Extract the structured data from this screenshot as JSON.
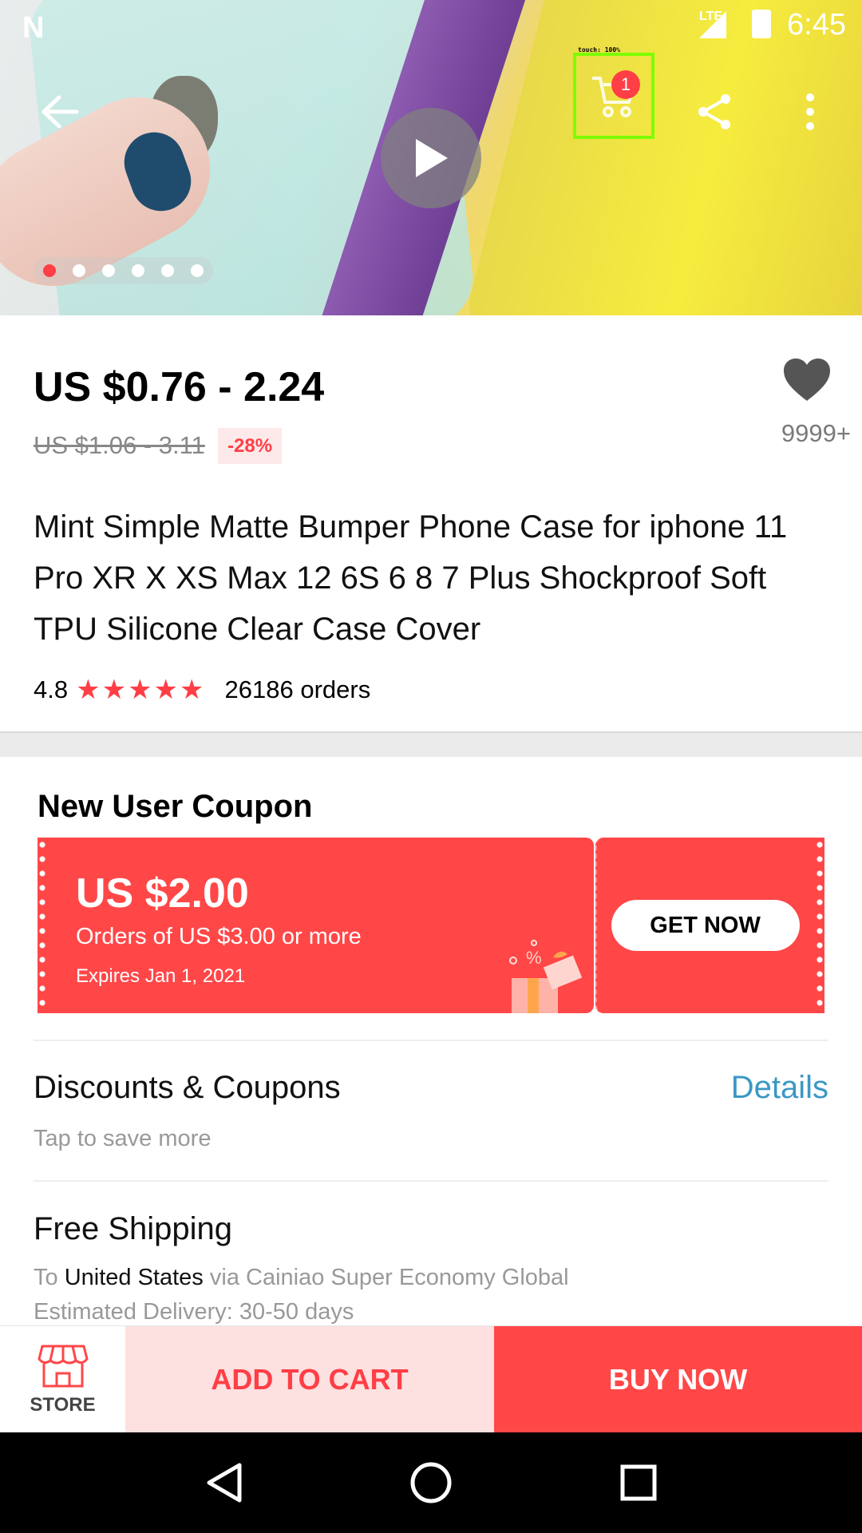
{
  "status_bar": {
    "clock": "6:45",
    "network": "LTE"
  },
  "hero": {
    "cart_count": "1",
    "touch_overlay": "touch: 100%",
    "gallery": {
      "count": 6,
      "active_index": 0
    }
  },
  "price": {
    "current": "US $0.76 - 2.24",
    "original": "US $1.06 - 3.11",
    "discount": "-28%",
    "wishlist_count": "9999+"
  },
  "product": {
    "title": "Mint Simple Matte Bumper Phone Case for iphone 11 Pro XR X XS Max 12 6S 6 8 7 Plus Shockproof Soft TPU Silicone Clear Case Cover",
    "rating": "4.8",
    "stars": 5,
    "orders": "26186 orders"
  },
  "coupon": {
    "heading": "New User Coupon",
    "amount": "US $2.00",
    "condition": "Orders of US $3.00 or more",
    "expires": "Expires Jan 1, 2021",
    "cta": "GET NOW"
  },
  "discounts": {
    "title": "Discounts & Coupons",
    "subtitle": "Tap to save more",
    "link": "Details"
  },
  "shipping": {
    "title": "Free Shipping",
    "to_prefix": "To",
    "country": "United States",
    "via": "via Cainiao Super Economy Global",
    "estimate": "Estimated Delivery: 30-50 days"
  },
  "actions": {
    "store": "STORE",
    "add_to_cart": "ADD TO CART",
    "buy_now": "BUY NOW"
  },
  "colors": {
    "accent": "#ff4748",
    "link": "#3a98c4",
    "touch_highlight": "#7cff00"
  }
}
